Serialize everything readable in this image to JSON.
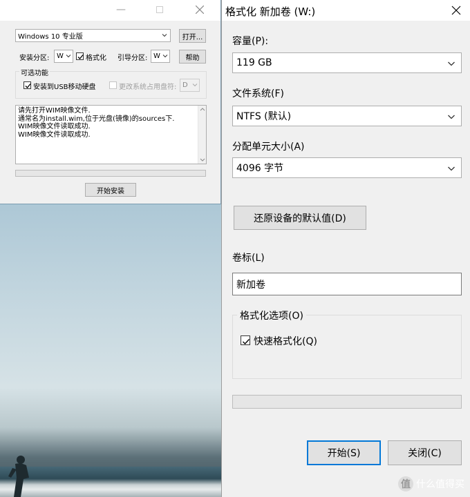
{
  "installer": {
    "edition_combo": "Windows 10 专业版",
    "open_button": "打开...",
    "install_partition_label": "安装分区:",
    "install_partition_value": "W",
    "format_checkbox_label": "格式化",
    "boot_partition_label": "引导分区:",
    "boot_partition_value": "W",
    "help_button": "帮助",
    "optional_group_label": "可选功能",
    "usb_checkbox_label": "安装到USB移动硬盘",
    "change_letter_label": "更改系统占用盘符:",
    "change_letter_value": "D",
    "log_lines": [
      "请先打开WIM映像文件.",
      "通常名为install.wim,位于光盘(镜像)的sources下.",
      "WIM映像文件读取成功.",
      "WIM映像文件读取成功."
    ],
    "start_button": "开始安装"
  },
  "format_dialog": {
    "title": "格式化 新加卷 (W:)",
    "capacity_label": "容量(P):",
    "capacity_value": "119 GB",
    "filesystem_label": "文件系统(F)",
    "filesystem_value": "NTFS (默认)",
    "alloc_label": "分配单元大小(A)",
    "alloc_value": "4096 字节",
    "restore_button": "还原设备的默认值(D)",
    "volume_label_label": "卷标(L)",
    "volume_label_value": "新加卷",
    "options_group_label": "格式化选项(O)",
    "quick_format_label": "快速格式化(Q)",
    "quick_format_checked": true,
    "progress": 0,
    "start_button": "开始(S)",
    "close_button": "关闭(C)"
  },
  "watermark": {
    "badge": "值",
    "text": "什么值得买"
  }
}
